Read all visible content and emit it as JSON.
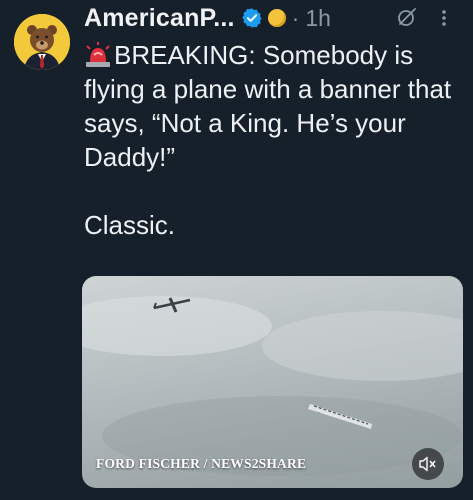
{
  "author": {
    "display_name": "AmericanP...",
    "separator": "·",
    "time_ago": "1h"
  },
  "tweet": {
    "line1": "BREAKING: Somebody is flying a plane with a banner that says, “Not a King. He’s your Daddy!”",
    "line2": "Classic."
  },
  "media": {
    "credit": "FORD FISCHER / NEWS2SHARE"
  },
  "icons": {
    "verified": "verified-badge-icon",
    "coin": "gold-coin-icon",
    "grok": "grok-icon",
    "more": "more-options-icon",
    "siren": "siren-icon",
    "mute": "muted-speaker-icon"
  },
  "colors": {
    "background": "#15202b",
    "verified": "#1d9bf0",
    "muted_text": "#8b98a5"
  }
}
